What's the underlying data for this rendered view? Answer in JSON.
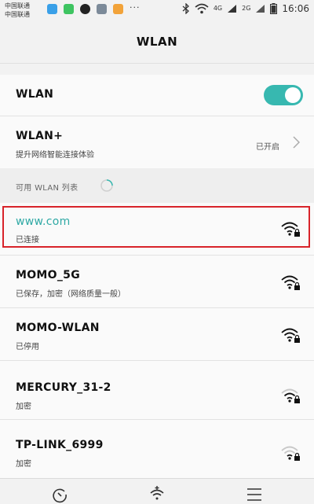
{
  "status_bar": {
    "carrier_line1": "中国联通",
    "carrier_line2": "中国联通",
    "more": "···",
    "network_1": "4G",
    "network_2": "2G",
    "time": "16:06"
  },
  "header": {
    "title": "WLAN"
  },
  "settings": {
    "wlan_label": "WLAN",
    "wlan_enabled": true,
    "wlan_plus_label": "WLAN+",
    "wlan_plus_subtitle": "提升网络智能连接体验",
    "wlan_plus_status": "已开启"
  },
  "available_header": "可用 WLAN 列表",
  "networks": [
    {
      "name": "www.com",
      "status": "已连接",
      "signal": 4,
      "secured": true,
      "connected": true
    },
    {
      "name": "MOMO_5G",
      "status": "已保存，加密（网络质量一般）",
      "signal": 4,
      "secured": true,
      "connected": false
    },
    {
      "name": "MOMO-WLAN",
      "status": "已停用",
      "signal": 4,
      "secured": true,
      "connected": false
    },
    {
      "name": "MERCURY_31-2",
      "status": "加密",
      "signal": 3,
      "secured": true,
      "connected": false
    },
    {
      "name": "TP-LINK_6999",
      "status": "加密",
      "signal": 2,
      "secured": true,
      "connected": false
    }
  ],
  "colors": {
    "accent": "#37b8b0",
    "connected_text": "#2fa9a5",
    "highlight": "#d8232a"
  },
  "icons": {
    "wifi": "wifi-lock-icon",
    "refresh": "refresh-icon",
    "add": "add-network-icon",
    "menu": "menu-icon"
  }
}
